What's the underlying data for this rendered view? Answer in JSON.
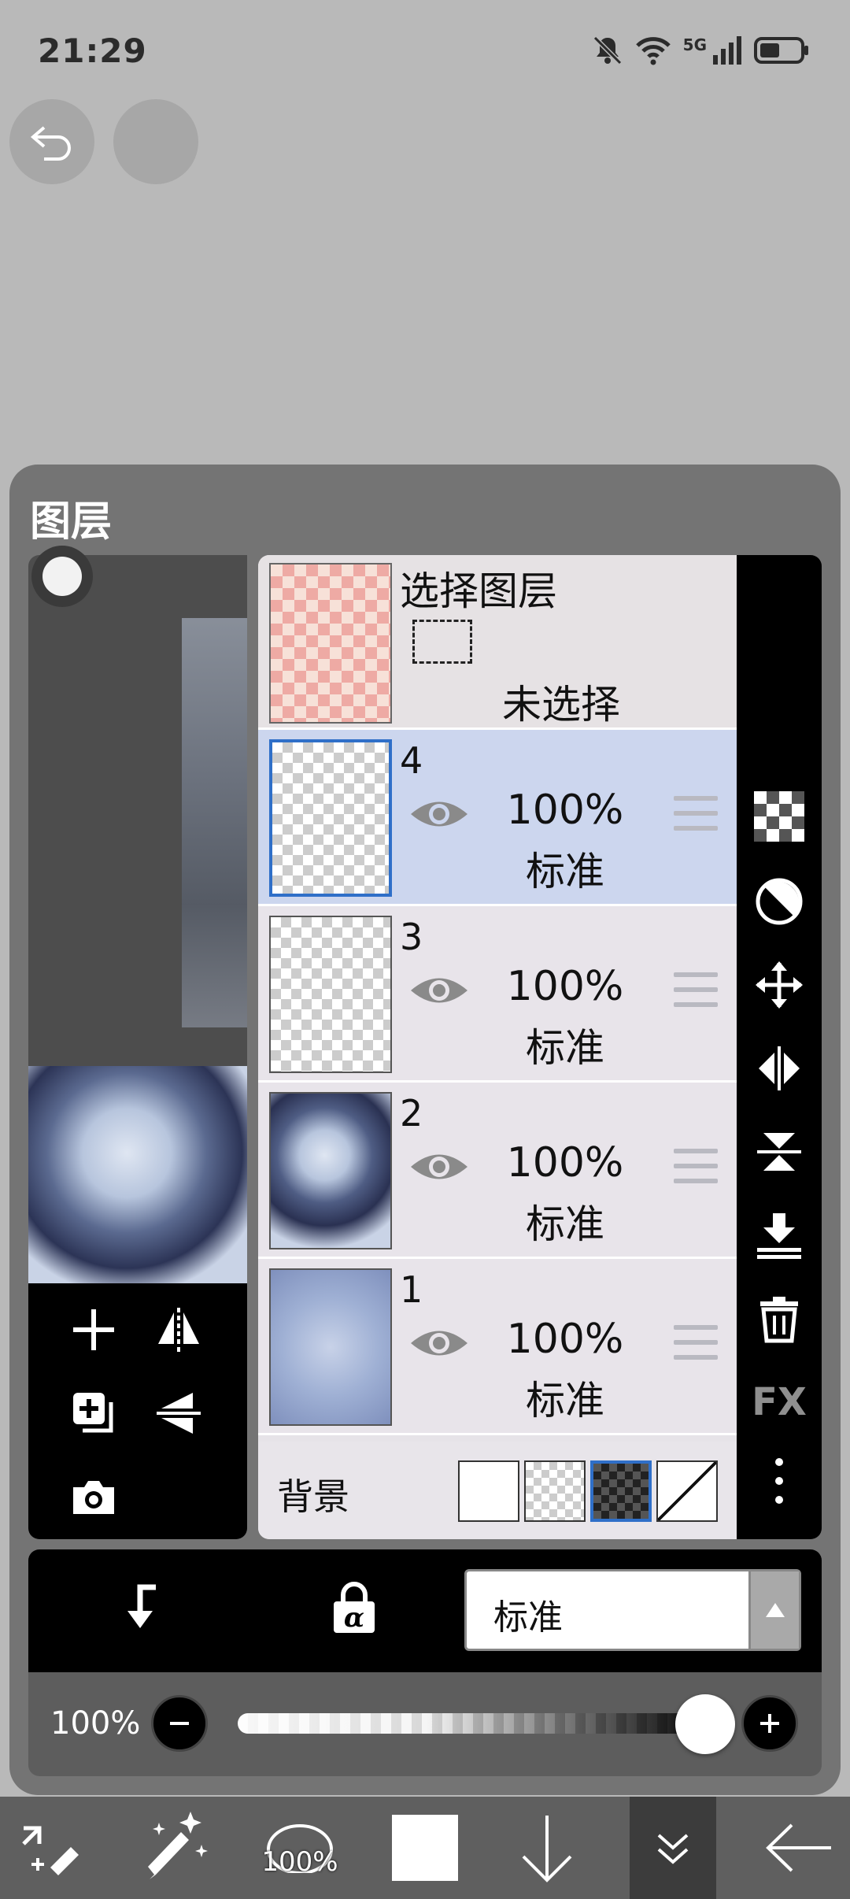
{
  "status_bar": {
    "time": "21:29",
    "network": "5G"
  },
  "panel": {
    "title": "图层"
  },
  "select_layer": {
    "title": "选择图层",
    "state": "未选择"
  },
  "layers": [
    {
      "number": "4",
      "opacity": "100%",
      "blend": "标准",
      "visible": true,
      "selected": true
    },
    {
      "number": "3",
      "opacity": "100%",
      "blend": "标准",
      "visible": true,
      "selected": false
    },
    {
      "number": "2",
      "opacity": "100%",
      "blend": "标准",
      "visible": true,
      "selected": false
    },
    {
      "number": "1",
      "opacity": "100%",
      "blend": "标准",
      "visible": true,
      "selected": false
    }
  ],
  "background": {
    "label": "背景",
    "options": [
      "white",
      "checker-light",
      "checker-dark",
      "none"
    ],
    "selected": "checker-dark"
  },
  "right_toolbar": {
    "fx_label": "FX"
  },
  "blend_mode": {
    "value": "标准"
  },
  "opacity": {
    "label": "100%",
    "value": 100
  },
  "bottom_nav": {
    "brush_size_label": "100%"
  },
  "colors": {
    "accent": "#2f6fc8",
    "panel": "#747474",
    "toolbar": "#000000"
  }
}
